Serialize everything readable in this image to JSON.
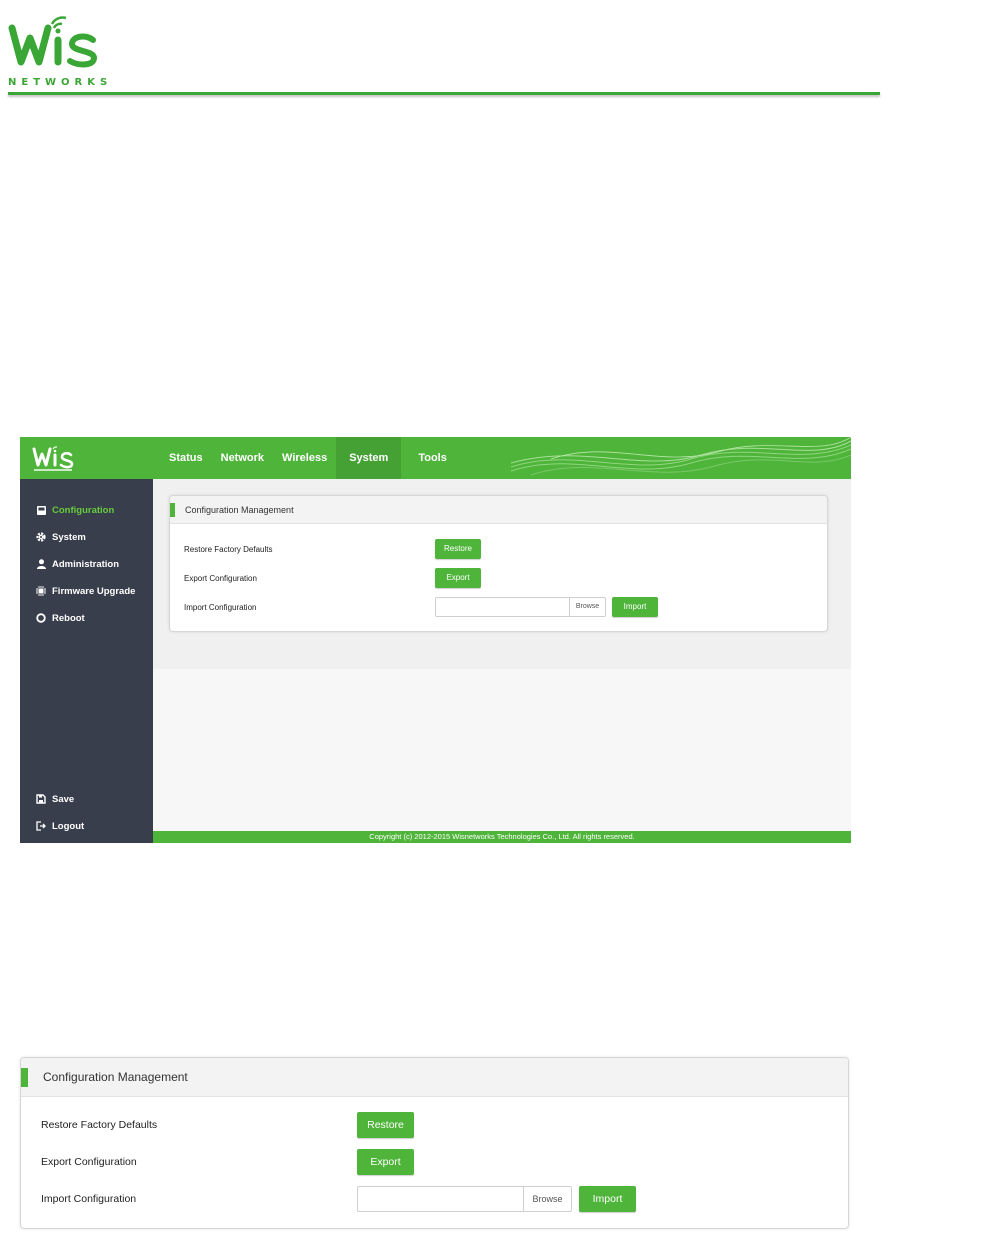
{
  "brand": {
    "logo_text": "WiS",
    "logo_subtext": "NETWORKS",
    "primary_color": "#4fb43a",
    "sidebar_color": "#383e4b"
  },
  "nav": {
    "items": [
      {
        "label": "Status",
        "active": false
      },
      {
        "label": "Network",
        "active": false
      },
      {
        "label": "Wireless",
        "active": false
      },
      {
        "label": "System",
        "active": true
      },
      {
        "label": "Tools",
        "active": false
      }
    ]
  },
  "sidebar": {
    "items": [
      {
        "label": "Configuration",
        "icon": "disk-icon",
        "active": true
      },
      {
        "label": "System",
        "icon": "gear-icon",
        "active": false
      },
      {
        "label": "Administration",
        "icon": "user-icon",
        "active": false
      },
      {
        "label": "Firmware Upgrade",
        "icon": "chip-icon",
        "active": false
      },
      {
        "label": "Reboot",
        "icon": "power-icon",
        "active": false
      }
    ],
    "bottom": [
      {
        "label": "Save",
        "icon": "save-icon"
      },
      {
        "label": "Logout",
        "icon": "logout-icon"
      }
    ]
  },
  "panel": {
    "title": "Configuration Management",
    "rows": [
      {
        "label": "Restore Factory Defaults",
        "button": "Restore"
      },
      {
        "label": "Export Configuration",
        "button": "Export"
      },
      {
        "label": "Import Configuration",
        "button": "Import"
      }
    ],
    "file_input": {
      "value": "",
      "browse_label": "Browse"
    }
  },
  "footer": {
    "copyright": "Copyright (c) 2012-2015 Wisnetworks Technologies Co., Ltd. All rights reserved."
  }
}
